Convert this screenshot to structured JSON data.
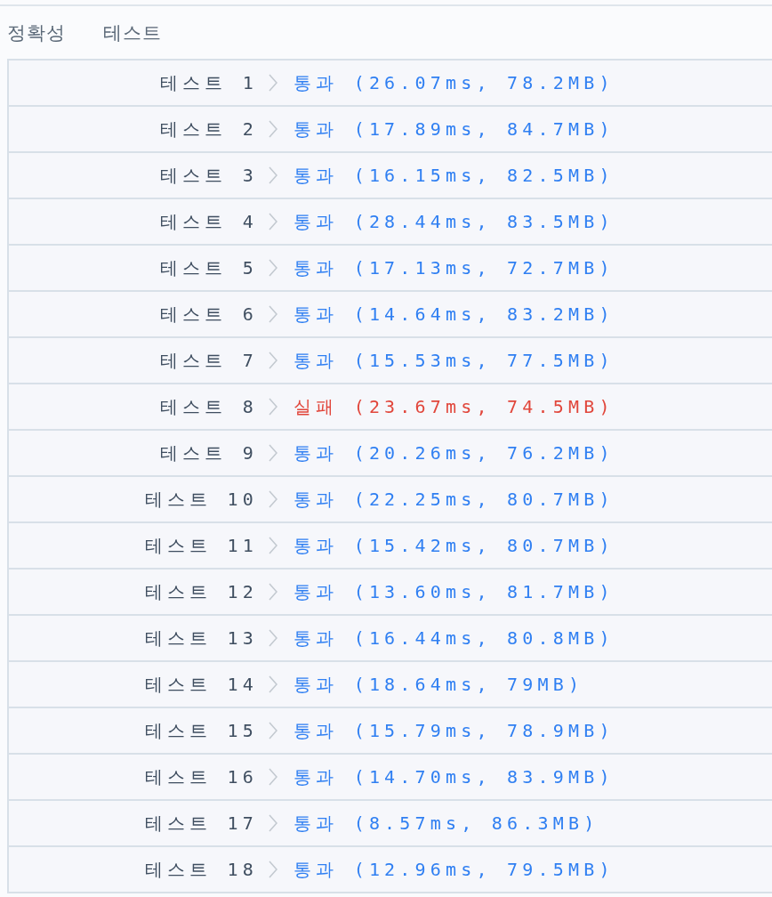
{
  "section_title": "정확성 테스트",
  "tests": [
    {
      "label": "테스트 1",
      "result": "통과 (26.07ms, 78.2MB)",
      "passed": true
    },
    {
      "label": "테스트 2",
      "result": "통과 (17.89ms, 84.7MB)",
      "passed": true
    },
    {
      "label": "테스트 3",
      "result": "통과 (16.15ms, 82.5MB)",
      "passed": true
    },
    {
      "label": "테스트 4",
      "result": "통과 (28.44ms, 83.5MB)",
      "passed": true
    },
    {
      "label": "테스트 5",
      "result": "통과 (17.13ms, 72.7MB)",
      "passed": true
    },
    {
      "label": "테스트 6",
      "result": "통과 (14.64ms, 83.2MB)",
      "passed": true
    },
    {
      "label": "테스트 7",
      "result": "통과 (15.53ms, 77.5MB)",
      "passed": true
    },
    {
      "label": "테스트 8",
      "result": "실패 (23.67ms, 74.5MB)",
      "passed": false
    },
    {
      "label": "테스트 9",
      "result": "통과 (20.26ms, 76.2MB)",
      "passed": true
    },
    {
      "label": "테스트 10",
      "result": "통과 (22.25ms, 80.7MB)",
      "passed": true
    },
    {
      "label": "테스트 11",
      "result": "통과 (15.42ms, 80.7MB)",
      "passed": true
    },
    {
      "label": "테스트 12",
      "result": "통과 (13.60ms, 81.7MB)",
      "passed": true
    },
    {
      "label": "테스트 13",
      "result": "통과 (16.44ms, 80.8MB)",
      "passed": true
    },
    {
      "label": "테스트 14",
      "result": "통과 (18.64ms, 79MB)",
      "passed": true
    },
    {
      "label": "테스트 15",
      "result": "통과 (15.79ms, 78.9MB)",
      "passed": true
    },
    {
      "label": "테스트 16",
      "result": "통과 (14.70ms, 83.9MB)",
      "passed": true
    },
    {
      "label": "테스트 17",
      "result": "통과 (8.57ms, 86.3MB)",
      "passed": true
    },
    {
      "label": "테스트 18",
      "result": "통과 (12.96ms, 79.5MB)",
      "passed": true
    }
  ]
}
